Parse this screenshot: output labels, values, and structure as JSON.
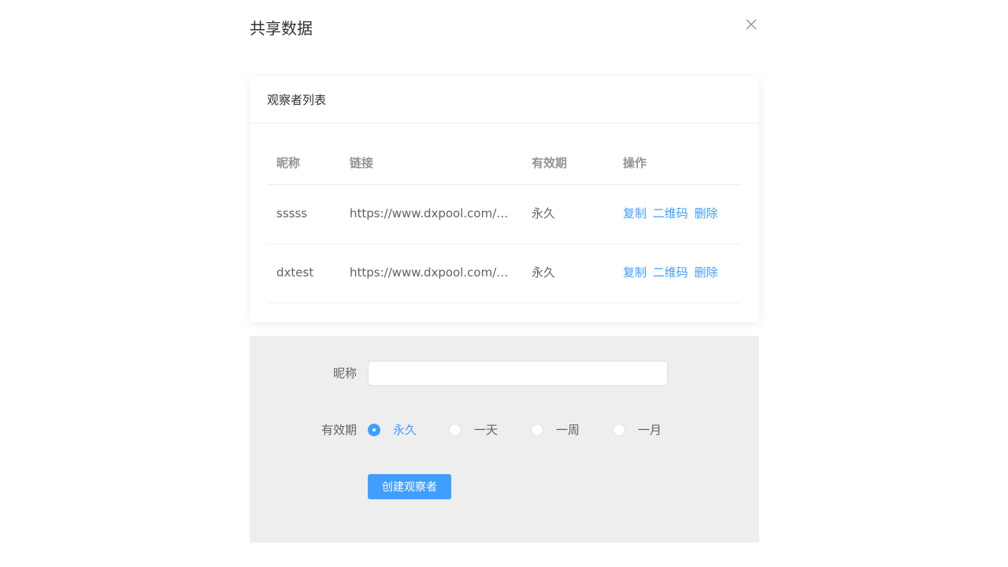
{
  "dialog": {
    "title": "共享数据",
    "close_icon": "close-icon"
  },
  "observer_list": {
    "title": "观察者列表",
    "columns": [
      "昵称",
      "链接",
      "有效期",
      "操作"
    ],
    "rows": [
      {
        "name": "sssss",
        "link": "https://www.dxpool.com/o…",
        "expiry": "永久",
        "actions": [
          "复制",
          "二维码",
          "删除"
        ]
      },
      {
        "name": "dxtest",
        "link": "https://www.dxpool.com/o…",
        "expiry": "永久",
        "actions": [
          "复制",
          "二维码",
          "删除"
        ]
      }
    ]
  },
  "form": {
    "nickname_label": "昵称",
    "nickname_value": "",
    "expiry_label": "有效期",
    "expiry_options": [
      "永久",
      "一天",
      "一周",
      "一月"
    ],
    "expiry_selected": "永久",
    "submit_label": "创建观察者"
  },
  "colors": {
    "accent": "#409eff",
    "panel_bg": "#eeeeee",
    "header_text": "#909399"
  }
}
